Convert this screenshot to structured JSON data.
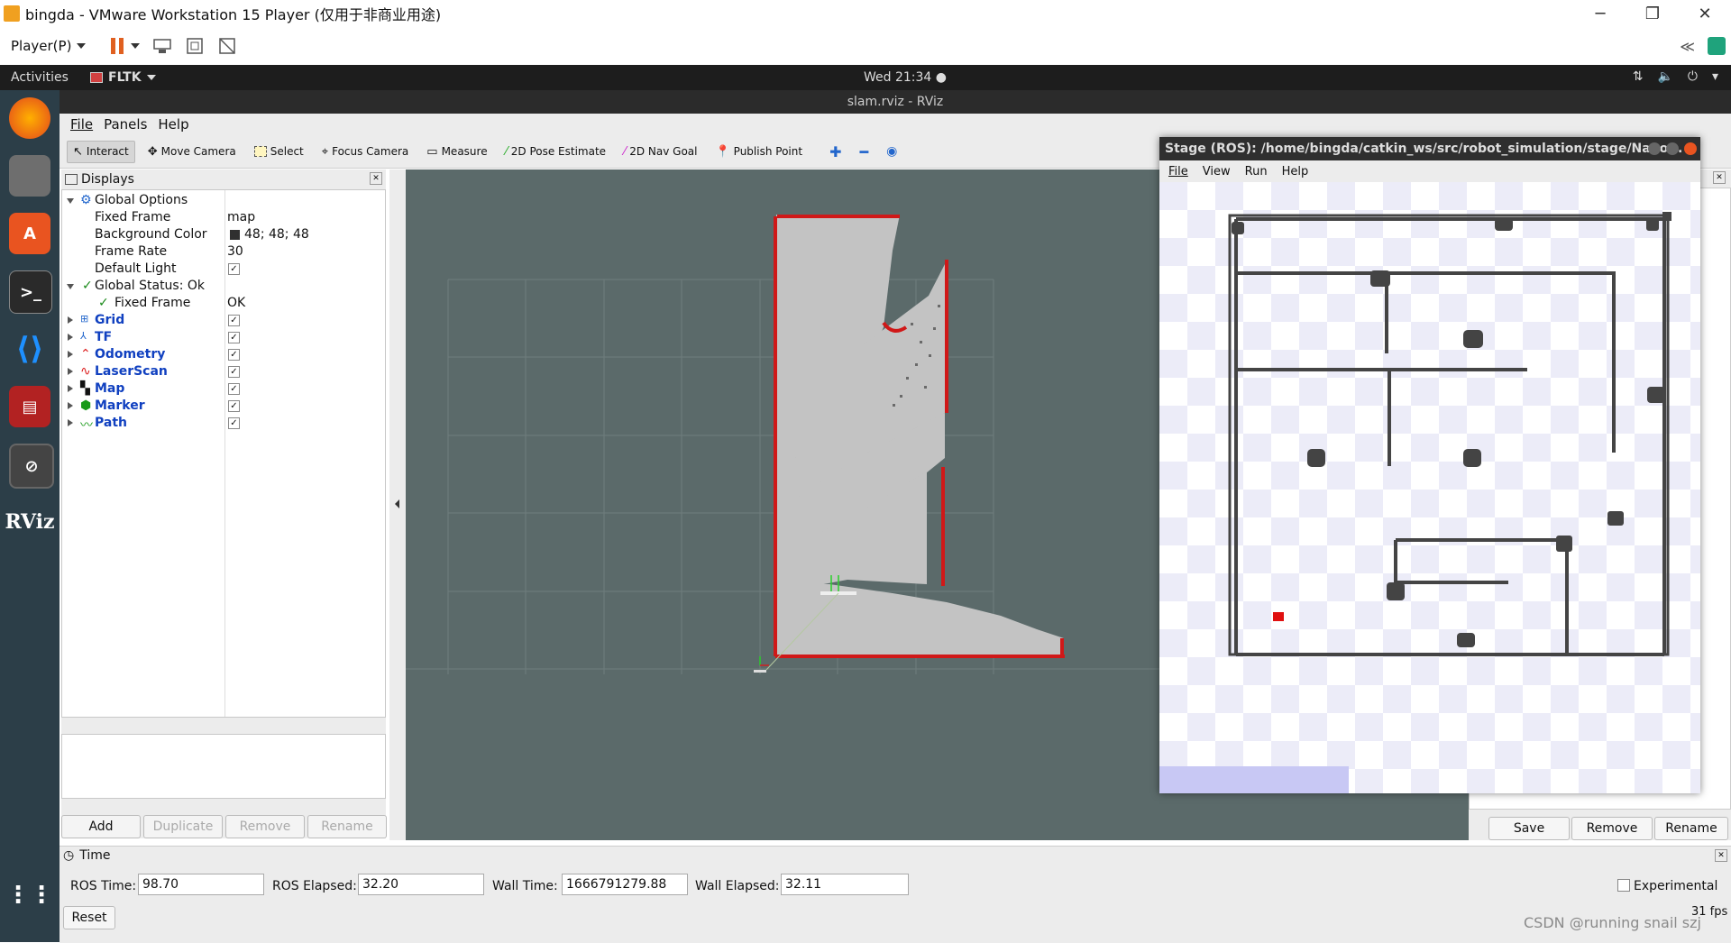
{
  "vmware": {
    "title": "bingda - VMware Workstation 15 Player (仅用于非商业用途)",
    "player_menu": "Player(P)",
    "controls": [
      "─",
      "❐",
      "✕"
    ]
  },
  "ubuntu": {
    "activities": "Activities",
    "app_name": "FLTK",
    "clock": "Wed 21:34 ●"
  },
  "rviz": {
    "window_title": "slam.rviz - RViz",
    "menu": [
      "File",
      "Panels",
      "Help"
    ],
    "tools": [
      {
        "label": "Interact",
        "icon": "interact-icon"
      },
      {
        "label": "Move Camera",
        "icon": "move-camera-icon"
      },
      {
        "label": "Select",
        "icon": "select-icon"
      },
      {
        "label": "Focus Camera",
        "icon": "focus-camera-icon"
      },
      {
        "label": "Measure",
        "icon": "measure-icon"
      },
      {
        "label": "2D Pose Estimate",
        "icon": "pose-estimate-icon"
      },
      {
        "label": "2D Nav Goal",
        "icon": "nav-goal-icon"
      },
      {
        "label": "Publish Point",
        "icon": "publish-point-icon"
      }
    ],
    "displays": {
      "title": "Displays",
      "global_options": "Global Options",
      "fixed_frame_label": "Fixed Frame",
      "fixed_frame_value": "map",
      "background_label": "Background Color",
      "background_value": "48; 48; 48",
      "frame_rate_label": "Frame Rate",
      "frame_rate_value": "30",
      "default_light_label": "Default Light",
      "global_status": "Global Status: Ok",
      "status_fixed_frame": "Fixed Frame",
      "status_fixed_frame_value": "OK",
      "items": [
        "Grid",
        "TF",
        "Odometry",
        "LaserScan",
        "Map",
        "Marker",
        "Path"
      ],
      "buttons": {
        "add": "Add",
        "duplicate": "Duplicate",
        "remove": "Remove",
        "rename": "Rename"
      }
    },
    "views_buttons": {
      "save": "Save",
      "remove": "Remove",
      "rename": "Rename"
    },
    "time": {
      "title": "Time",
      "ros_time_label": "ROS Time:",
      "ros_time": "98.70",
      "ros_elapsed_label": "ROS Elapsed:",
      "ros_elapsed": "32.20",
      "wall_time_label": "Wall Time:",
      "wall_time": "1666791279.88",
      "wall_elapsed_label": "Wall Elapsed:",
      "wall_elapsed": "32.11",
      "experimental": "Experimental",
      "reset": "Reset",
      "fps": "31 fps"
    }
  },
  "stage": {
    "title": "Stage (ROS): /home/bingda/catkin_ws/src/robot_simulation/stage/Nano...",
    "menu": [
      "File",
      "View",
      "Run",
      "Help"
    ]
  },
  "watermark": "CSDN @running snail szj"
}
